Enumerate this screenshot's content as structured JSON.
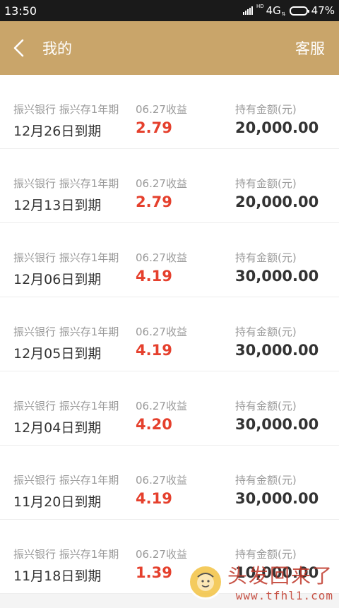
{
  "status_bar": {
    "time": "13:50",
    "hd_label": "HD",
    "network": "4G",
    "battery": "47%",
    "battery_level": 0.47
  },
  "header": {
    "title": "我的",
    "service_label": "客服"
  },
  "items": [
    {
      "product": "振兴银行 振兴存1年期",
      "maturity": "12月26日到期",
      "earn_label": "06.27收益",
      "earn_value": "2.79",
      "hold_label": "持有金额(元)",
      "hold_value": "20,000.00"
    },
    {
      "product": "振兴银行 振兴存1年期",
      "maturity": "12月13日到期",
      "earn_label": "06.27收益",
      "earn_value": "2.79",
      "hold_label": "持有金额(元)",
      "hold_value": "20,000.00"
    },
    {
      "product": "振兴银行 振兴存1年期",
      "maturity": "12月06日到期",
      "earn_label": "06.27收益",
      "earn_value": "4.19",
      "hold_label": "持有金额(元)",
      "hold_value": "30,000.00"
    },
    {
      "product": "振兴银行 振兴存1年期",
      "maturity": "12月05日到期",
      "earn_label": "06.27收益",
      "earn_value": "4.19",
      "hold_label": "持有金额(元)",
      "hold_value": "30,000.00"
    },
    {
      "product": "振兴银行 振兴存1年期",
      "maturity": "12月04日到期",
      "earn_label": "06.27收益",
      "earn_value": "4.20",
      "hold_label": "持有金额(元)",
      "hold_value": "30,000.00"
    },
    {
      "product": "振兴银行 振兴存1年期",
      "maturity": "11月20日到期",
      "earn_label": "06.27收益",
      "earn_value": "4.19",
      "hold_label": "持有金额(元)",
      "hold_value": "30,000.00"
    },
    {
      "product": "振兴银行 振兴存1年期",
      "maturity": "11月18日到期",
      "earn_label": "06.27收益",
      "earn_value": "1.39",
      "hold_label": "持有金额(元)",
      "hold_value": "10,000.00"
    }
  ],
  "watermark": {
    "main": "头发回来了",
    "url": "www.tfhl1.com"
  },
  "colors": {
    "header_bg": "#c9a56a",
    "earn_red": "#e5402d"
  }
}
